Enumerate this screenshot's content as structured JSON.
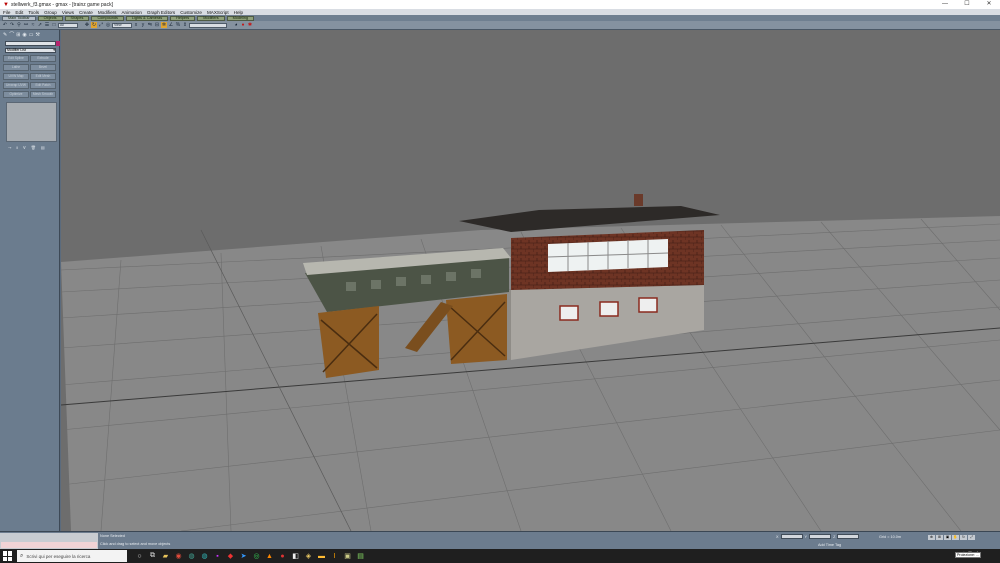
{
  "window": {
    "title": "stellwerk_f3.gmax - gmax - [trainz game pack]",
    "minimize": "—",
    "maximize": "☐",
    "close": "✕"
  },
  "menu": [
    "File",
    "Edit",
    "Tools",
    "Group",
    "Views",
    "Create",
    "Modifiers",
    "Animation",
    "Graph Editors",
    "Customize",
    "MAXScript",
    "Help"
  ],
  "tabs": [
    "Main Toolbar",
    "Objects",
    "Shapes",
    "Compounds",
    "Lights & Cameras",
    "Helpers",
    "Modifiers",
    "Modeling"
  ],
  "toolbar": {
    "selection_filter": "All",
    "coord_system": "View",
    "named_selection": ""
  },
  "command_panel": {
    "modifier_list": "Modifier List",
    "buttons": [
      "Edit Spline",
      "Extrude",
      "Lathe",
      "Bevel",
      "UVW Map",
      "Edit Mesh",
      "Unwrap UVW",
      "Edit Patch",
      "Optimize",
      "Mesh Smooth"
    ]
  },
  "status": {
    "selection": "None Selected",
    "prompt": "Click and drag to select and move objects",
    "x": "",
    "y": "",
    "z": "",
    "grid": "Grid = 10.0m",
    "add_time_tag": "Add Time Tag",
    "animate": "Animate"
  },
  "taskbar": {
    "search_placeholder": "Scrivi qui per eseguire la ricerca",
    "time": "",
    "date": "",
    "tooltip": "Proiezione: ..."
  },
  "colors": {
    "viewport": "#6d6d6d",
    "panel": "#6b7c8e",
    "tab_green": "#8fa07a"
  }
}
